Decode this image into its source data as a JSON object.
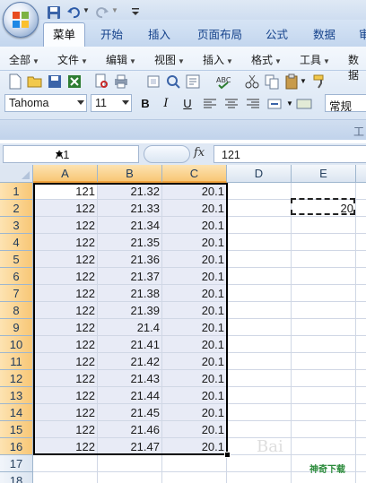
{
  "quick_access": {
    "customize_arrow": "▼"
  },
  "tabs": [
    "菜单",
    "开始",
    "插入",
    "页面布局",
    "公式",
    "数据",
    "审"
  ],
  "menus": [
    "全部",
    "文件",
    "编辑",
    "视图",
    "插入",
    "格式",
    "工具",
    "数据"
  ],
  "font": {
    "name": "Tahoma",
    "size": "11",
    "style": "常规"
  },
  "format_buttons": {
    "bold": "B",
    "italic": "I",
    "underline": "U"
  },
  "ribbon_group_label": "工",
  "name_box": "A1",
  "fx_label": "fx",
  "formula_value": "121",
  "columns": [
    "A",
    "B",
    "C",
    "D",
    "E"
  ],
  "rows": [
    {
      "n": "1",
      "a": "121",
      "b": "21.32",
      "c": "20.1"
    },
    {
      "n": "2",
      "a": "122",
      "b": "21.33",
      "c": "20.1"
    },
    {
      "n": "3",
      "a": "122",
      "b": "21.34",
      "c": "20.1"
    },
    {
      "n": "4",
      "a": "122",
      "b": "21.35",
      "c": "20.1"
    },
    {
      "n": "5",
      "a": "122",
      "b": "21.36",
      "c": "20.1"
    },
    {
      "n": "6",
      "a": "122",
      "b": "21.37",
      "c": "20.1"
    },
    {
      "n": "7",
      "a": "122",
      "b": "21.38",
      "c": "20.1"
    },
    {
      "n": "8",
      "a": "122",
      "b": "21.39",
      "c": "20.1"
    },
    {
      "n": "9",
      "a": "122",
      "b": "21.4",
      "c": "20.1"
    },
    {
      "n": "10",
      "a": "122",
      "b": "21.41",
      "c": "20.1"
    },
    {
      "n": "11",
      "a": "122",
      "b": "21.42",
      "c": "20.1"
    },
    {
      "n": "12",
      "a": "122",
      "b": "21.43",
      "c": "20.1"
    },
    {
      "n": "13",
      "a": "122",
      "b": "21.44",
      "c": "20.1"
    },
    {
      "n": "14",
      "a": "122",
      "b": "21.45",
      "c": "20.1"
    },
    {
      "n": "15",
      "a": "122",
      "b": "21.46",
      "c": "20.1"
    },
    {
      "n": "16",
      "a": "122",
      "b": "21.47",
      "c": "20.1"
    },
    {
      "n": "17",
      "a": "",
      "b": "",
      "c": ""
    },
    {
      "n": "18",
      "a": "",
      "b": "",
      "c": ""
    }
  ],
  "e2_value": "20",
  "watermark": "神奇下载",
  "watermark_baidu": "Bai"
}
